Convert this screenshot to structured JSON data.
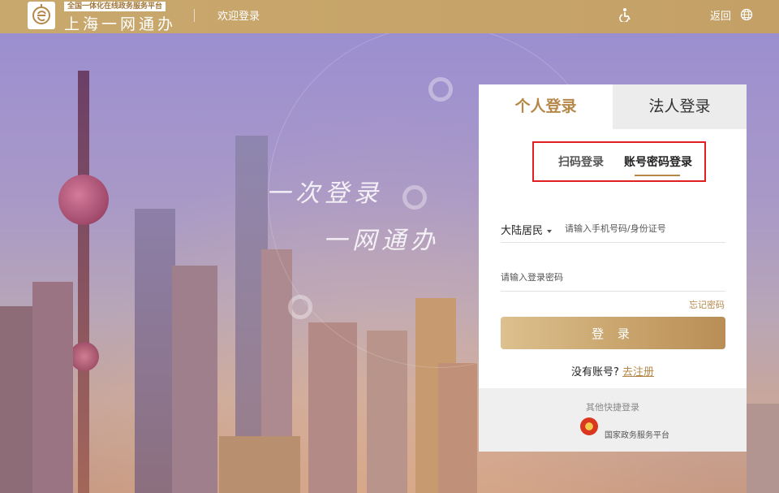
{
  "topbar": {
    "brand_sub": "全国一体化在线政务服务平台",
    "brand_main": "上海一网通办",
    "welcome": "欢迎登录",
    "back": "返回",
    "icons": [
      "accessibility-icon",
      "globe-icon"
    ],
    "accent": "#c9a86d"
  },
  "slogan": {
    "line1": "一次登录",
    "line2": "一网通办"
  },
  "login": {
    "tabs": [
      {
        "label": "个人登录",
        "active": true
      },
      {
        "label": "法人登录",
        "active": false
      }
    ],
    "modes": [
      {
        "label": "扫码登录",
        "active": false
      },
      {
        "label": "账号密码登录",
        "active": true
      }
    ],
    "region": "大陆居民",
    "user_placeholder": "请输入手机号码/身份证号",
    "password_placeholder": "请输入登录密码",
    "forgot": "忘记密码",
    "submit": "登 录",
    "no_account": "没有账号?",
    "register": "去注册",
    "quick_title": "其他快捷登录",
    "quick_option": "国家政务服务平台",
    "highlight_color": "#e02020",
    "gold": "#b5884a"
  }
}
